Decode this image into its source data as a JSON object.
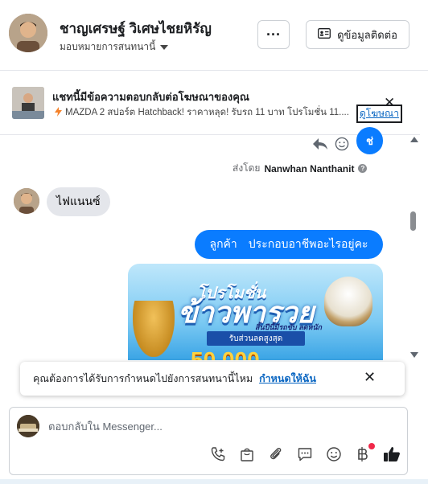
{
  "header": {
    "contact_name": "ชาญเศรษฐ์ วิเศษไชยหิรัญ",
    "assign_label": "มอบหมายการสนทนานี้",
    "more_label": "···",
    "contact_info_label": "ดูข้อมูลติดต่อ"
  },
  "ad_banner": {
    "title": "แชทนี้มีข้อความตอบกลับต่อโฆษณาของคุณ",
    "subtitle": "MAZDA 2 สปอร์ต Hatchback! ราคาหลุด! รับรถ 11 บาท โปรโมชั่น 11....",
    "link_label": "ดูโฆษณา",
    "close_label": "✕"
  },
  "messages": {
    "out_small": "ช่",
    "sent_by_prefix": "ส่งโดย",
    "sent_by_name": "Nanwhan Nanthanit",
    "info_label": "?",
    "in_text": "ไฟแนนซ์",
    "out_text_1": "ลูกค้า",
    "out_text_2": "ประกอบอาชีพอะไรอยู่คะ"
  },
  "promo_image": {
    "line1": "โปรโมชั่น",
    "line2": "ข้าวพารวย",
    "tagline": "สิ้นปีนี้มีรถขับ ลดหนัก",
    "badge": "รับส่วนลดสูงสุด",
    "amount": "50,000"
  },
  "toast": {
    "text": "คุณต้องการได้รับการกำหนดไปยังการสนทนานี้ไหม",
    "link": "กำหนดให้ฉัน",
    "close": "✕"
  },
  "composer": {
    "placeholder": "ตอบกลับใน Messenger..."
  },
  "toolbar": {
    "tools": [
      "phone-plus-icon",
      "shopping-bag-icon",
      "paperclip-icon",
      "saved-reply-icon",
      "emoji-icon",
      "baht-icon",
      "like-icon"
    ]
  },
  "colors": {
    "accent": "#0a7cff",
    "link": "#0a66c2",
    "notification": "#f02849"
  }
}
